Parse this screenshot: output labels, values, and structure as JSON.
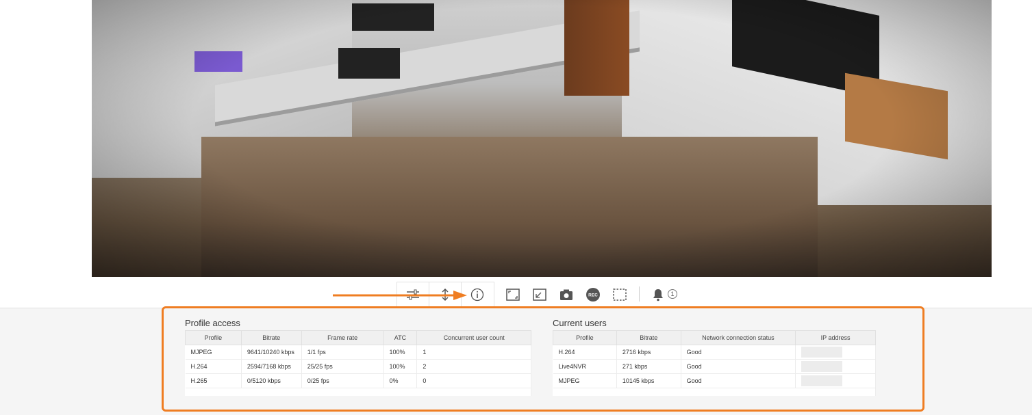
{
  "toolbar": {
    "buttons": [
      {
        "icon": "sliders-icon"
      },
      {
        "icon": "vertical-resize-icon"
      },
      {
        "icon": "info-icon"
      },
      {
        "icon": "fullscreen-icon"
      },
      {
        "icon": "fit-screen-icon"
      },
      {
        "icon": "camera-snapshot-icon"
      },
      {
        "icon": "record-icon",
        "label": "REC"
      },
      {
        "icon": "select-region-icon"
      },
      {
        "icon": "bell-icon"
      }
    ],
    "notification_count": "1"
  },
  "colors": {
    "highlight": "#ef7d22",
    "arrow": "#ef7d22"
  },
  "profile_access": {
    "title": "Profile access",
    "columns": [
      "Profile",
      "Bitrate",
      "Frame rate",
      "ATC",
      "Concurrent user count"
    ],
    "rows": [
      [
        "MJPEG",
        "9641/10240 kbps",
        "1/1 fps",
        "100%",
        "1"
      ],
      [
        "H.264",
        "2594/7168 kbps",
        "25/25 fps",
        "100%",
        "2"
      ],
      [
        "H.265",
        "0/5120 kbps",
        "0/25 fps",
        "0%",
        "0"
      ]
    ]
  },
  "current_users": {
    "title": "Current users",
    "columns": [
      "Profile",
      "Bitrate",
      "Network connection status",
      "IP address"
    ],
    "rows": [
      [
        "H.264",
        "2716 kbps",
        "Good",
        ""
      ],
      [
        "Live4NVR",
        "271 kbps",
        "Good",
        ""
      ],
      [
        "MJPEG",
        "10145 kbps",
        "Good",
        ""
      ]
    ]
  }
}
